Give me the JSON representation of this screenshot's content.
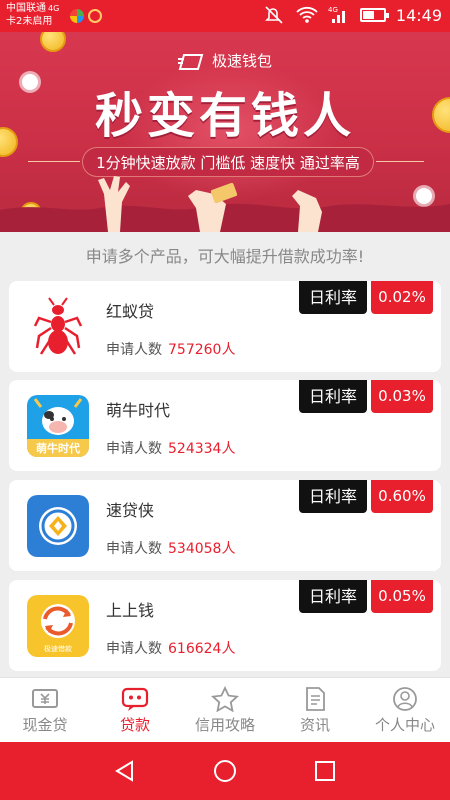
{
  "status_bar": {
    "carrier_line1": "中国联通",
    "network": "4G",
    "carrier_line2": "卡2未启用",
    "signal_label": "4G",
    "battery_level": 0.55,
    "time": "14:49"
  },
  "banner": {
    "brand": "极速钱包",
    "headline": "秒变有钱人",
    "tagline": "1分钟快速放款 门槛低 速度快 通过率高"
  },
  "subtitle": "申请多个产品，可大幅提升借款成功率!",
  "products": [
    {
      "name": "红蚁贷",
      "apply_label": "申请人数",
      "apply_count": "757260人",
      "rate_label": "日利率",
      "rate": "0.02%",
      "logo": "red-ant-icon"
    },
    {
      "name": "萌牛时代",
      "apply_label": "申请人数",
      "apply_count": "524334人",
      "rate_label": "日利率",
      "rate": "0.03%",
      "logo": "cow-icon",
      "logo_text": "萌牛时代"
    },
    {
      "name": "速贷侠",
      "apply_label": "申请人数",
      "apply_count": "534058人",
      "rate_label": "日利率",
      "rate": "0.60%",
      "logo": "coin-circle-icon"
    },
    {
      "name": "上上钱",
      "apply_label": "申请人数",
      "apply_count": "616624人",
      "rate_label": "日利率",
      "rate": "0.05%",
      "logo": "swap-coin-icon",
      "logo_text": "极速借款"
    }
  ],
  "bottom_nav": [
    {
      "label": "现金贷",
      "icon": "cash-icon",
      "active": false
    },
    {
      "label": "贷款",
      "icon": "chat-icon",
      "active": true
    },
    {
      "label": "信用攻略",
      "icon": "star-icon",
      "active": false
    },
    {
      "label": "资讯",
      "icon": "document-icon",
      "active": false
    },
    {
      "label": "个人中心",
      "icon": "user-icon",
      "active": false
    }
  ],
  "colors": {
    "accent": "#e8202e",
    "banner": "#c92f46",
    "rate_tag": "#111111"
  }
}
